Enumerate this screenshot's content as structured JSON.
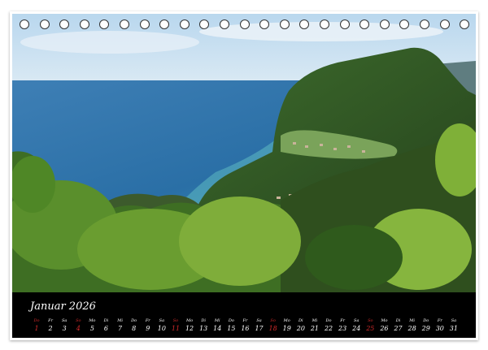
{
  "calendar": {
    "month_label": "Januar 2026",
    "days": [
      {
        "wd": "Do",
        "d": "1",
        "red": true
      },
      {
        "wd": "Fr",
        "d": "2",
        "red": false
      },
      {
        "wd": "Sa",
        "d": "3",
        "red": false
      },
      {
        "wd": "So",
        "d": "4",
        "red": true
      },
      {
        "wd": "Mo",
        "d": "5",
        "red": false
      },
      {
        "wd": "Di",
        "d": "6",
        "red": false
      },
      {
        "wd": "Mi",
        "d": "7",
        "red": false
      },
      {
        "wd": "Do",
        "d": "8",
        "red": false
      },
      {
        "wd": "Fr",
        "d": "9",
        "red": false
      },
      {
        "wd": "Sa",
        "d": "10",
        "red": false
      },
      {
        "wd": "So",
        "d": "11",
        "red": true
      },
      {
        "wd": "Mo",
        "d": "12",
        "red": false
      },
      {
        "wd": "Di",
        "d": "13",
        "red": false
      },
      {
        "wd": "Mi",
        "d": "14",
        "red": false
      },
      {
        "wd": "Do",
        "d": "15",
        "red": false
      },
      {
        "wd": "Fr",
        "d": "16",
        "red": false
      },
      {
        "wd": "Sa",
        "d": "17",
        "red": false
      },
      {
        "wd": "So",
        "d": "18",
        "red": true
      },
      {
        "wd": "Mo",
        "d": "19",
        "red": false
      },
      {
        "wd": "Di",
        "d": "20",
        "red": false
      },
      {
        "wd": "Mi",
        "d": "21",
        "red": false
      },
      {
        "wd": "Do",
        "d": "22",
        "red": false
      },
      {
        "wd": "Fr",
        "d": "23",
        "red": false
      },
      {
        "wd": "Sa",
        "d": "24",
        "red": false
      },
      {
        "wd": "So",
        "d": "25",
        "red": true
      },
      {
        "wd": "Mo",
        "d": "26",
        "red": false
      },
      {
        "wd": "Di",
        "d": "27",
        "red": false
      },
      {
        "wd": "Mi",
        "d": "28",
        "red": false
      },
      {
        "wd": "Do",
        "d": "29",
        "red": false
      },
      {
        "wd": "Fr",
        "d": "30",
        "red": false
      },
      {
        "wd": "Sa",
        "d": "31",
        "red": false
      }
    ]
  },
  "colors": {
    "holiday": "#d02a2a",
    "day_text": "#ffffff",
    "bar": "#000000"
  }
}
